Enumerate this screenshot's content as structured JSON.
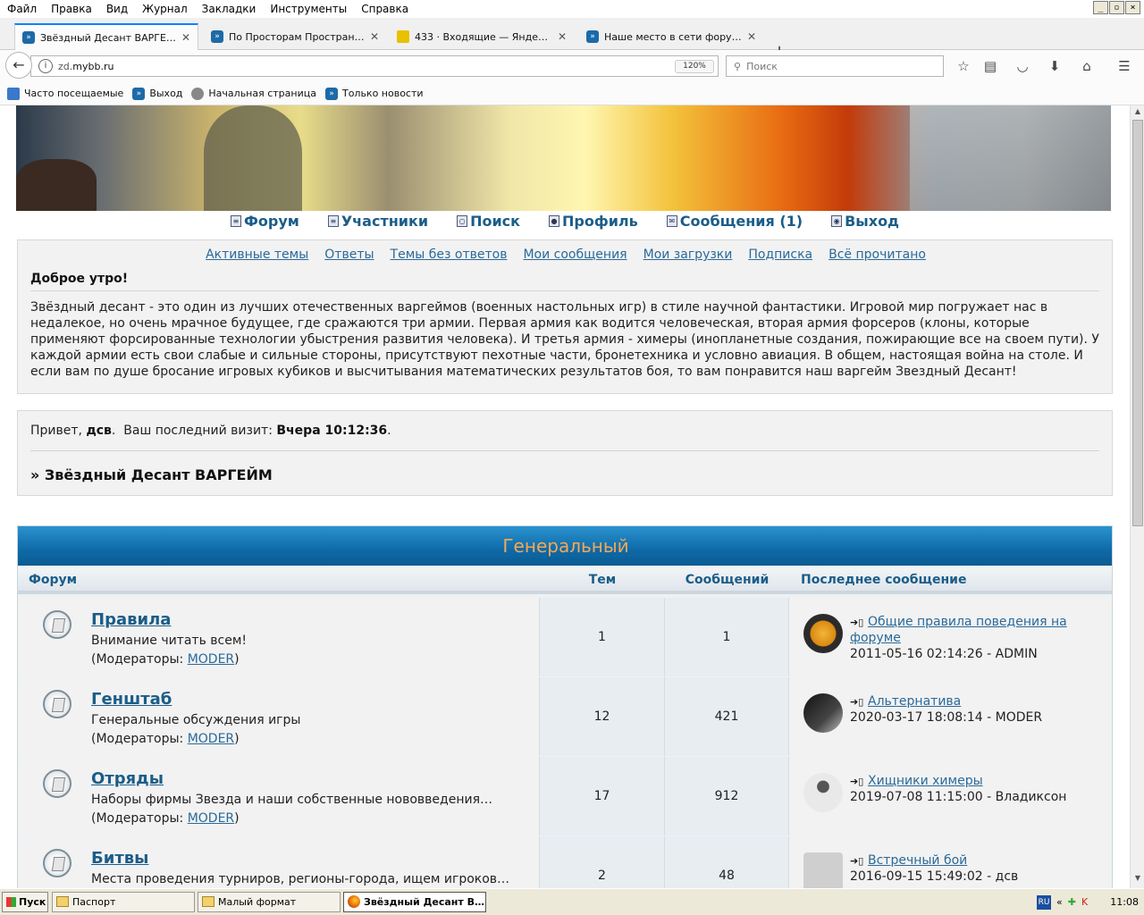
{
  "menubar": {
    "items": [
      "Файл",
      "Правка",
      "Вид",
      "Журнал",
      "Закладки",
      "Инструменты",
      "Справка"
    ]
  },
  "tabs": [
    {
      "title": "Звёздный Десант ВАРГЕЙМ",
      "active": true
    },
    {
      "title": "По Просторам Пространства",
      "active": false
    },
    {
      "title": "433 · Входящие — Яндекс…",
      "active": false
    },
    {
      "title": "Наше место в сети форумов…",
      "active": false
    }
  ],
  "navbar": {
    "url_prefix": "zd.",
    "url_host": "mybb.ru",
    "zoom": "120%",
    "search_placeholder": "Поиск"
  },
  "bookmarks": [
    "Часто посещаемые",
    "Выход",
    "Начальная страница",
    "Только новости"
  ],
  "topnav": [
    "Форум",
    "Участники",
    "Поиск",
    "Профиль",
    "Сообщения (1)",
    "Выход"
  ],
  "sublinks": [
    "Активные темы",
    "Ответы",
    "Темы без ответов",
    "Мои сообщения",
    "Мои загрузки",
    "Подписка",
    "Всё прочитано"
  ],
  "greeting": {
    "title": "Доброе утро!",
    "text": "Звёздный десант - это один из лучших отечественных варгеймов (военных настольных игр) в стиле научной фантастики. Игровой мир погружает нас в недалекое, но очень мрачное будущее, где сражаются три армии. Первая армия как водится человеческая, вторая армия форсеров (клоны, которые применяют форсированные технологии убыстрения развития человека). И третья армия - химеры (инопланетные создания, пожирающие все на своем пути). У каждой армии есть свои слабые и сильные стороны, присутствуют пехотные части, бронетехника и условно авиация. В общем, настоящая война на столе. И если вам по душе бросание игровых кубиков и высчитывания математических результатов боя, то вам понравится наш варгейм Звездный Десант!"
  },
  "welcome": {
    "hello": "Привет,",
    "user": "дсв",
    "last_visit_label": "Ваш последний визит:",
    "last_visit": "Вчера 10:12:36",
    "crumb": "» Звёздный Десант ВАРГЕЙМ"
  },
  "forum": {
    "category": "Генеральный",
    "columns": [
      "Форум",
      "Тем",
      "Сообщений",
      "Последнее сообщение"
    ],
    "moderators_label": "(Модераторы:",
    "rows": [
      {
        "name": "Правила",
        "desc": "Внимание читать всем!",
        "moderator": "MODER",
        "topics": "1",
        "posts": "1",
        "last_title": "Общие правила поведения на форуме",
        "last_meta": "2011-05-16 02:14:26 - ADMIN",
        "avatar": "admin"
      },
      {
        "name": "Генштаб",
        "desc": "Генеральные обсуждения игры",
        "moderator": "MODER",
        "topics": "12",
        "posts": "421",
        "last_title": "Альтернатива",
        "last_meta": "2020-03-17 18:08:14 - MODER",
        "avatar": "moder"
      },
      {
        "name": "Отряды",
        "desc": "Наборы фирмы Звезда и наши собственные нововведения…",
        "moderator": "MODER",
        "topics": "17",
        "posts": "912",
        "last_title": "Хищники химеры",
        "last_meta": "2019-07-08 11:15:00 - Владиксон",
        "avatar": "user"
      },
      {
        "name": "Битвы",
        "desc": "Места проведения турниров, регионы-города, ищем игроков…",
        "moderator": "",
        "topics": "2",
        "posts": "48",
        "last_title": "Встречный бой",
        "last_meta": "2016-09-15 15:49:02 - дсв",
        "avatar": "dsv"
      }
    ]
  },
  "taskbar": {
    "start": "Пуск",
    "items": [
      "Паспорт",
      "Малый формат",
      "Звёздный Десант В…"
    ],
    "lang": "RU",
    "clock": "11:08"
  }
}
